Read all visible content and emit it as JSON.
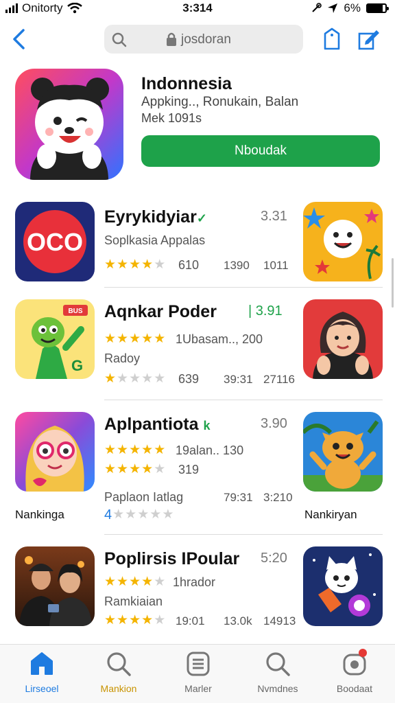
{
  "status": {
    "carrier": "Onitorty",
    "time": "3:314",
    "battery": "6%",
    "battery_level": 0.85
  },
  "nav": {
    "search_text": "josdoran"
  },
  "featured": {
    "title": "Indonnesia",
    "subtitle": "Appking.., Ronukain, Balan",
    "meta": "Mek  1091s",
    "button": "Nboudak",
    "icon": "bear-character-icon"
  },
  "apps": [
    {
      "name": "Eyrykidyiar",
      "name_mark": "✓",
      "score": "3.31",
      "line1": "Soplkasia Appalas",
      "rating_stars": 4,
      "rating_note": "610",
      "meta1": "1390",
      "meta2": "1011",
      "icon": "red-oco-logo-icon",
      "side_icon": "smiling-star-face-icon"
    },
    {
      "name": "Aqnkar Poder",
      "score": "| 3.91",
      "line1_stars": 5,
      "line1_note": "1Ubasam.., 200",
      "line2": "Radoy",
      "rating_stars": 1,
      "rating_note": "639",
      "meta1": "39:31",
      "meta2": "27116",
      "icon": "green-alien-character-icon",
      "side_icon": "waving-woman-icon",
      "icon_badge": "BUS"
    },
    {
      "name": "Aplpantiota",
      "name_mark": "k",
      "score": "3.90",
      "line1_stars": 5,
      "line1_note": "19alan.. 130",
      "line2_stars": 4,
      "line2_note": "319",
      "line3": "Paplaon Iatlag",
      "meta1": "79:31",
      "meta2": "3:210",
      "rating_stars": 0,
      "rating_prefix": "4",
      "caption_left": "Nankinga",
      "caption_right": "Nankiryan",
      "icon": "girl-with-glasses-icon",
      "side_icon": "orange-cat-character-icon"
    },
    {
      "name": "Poplirsis IPoular",
      "score": "5:20",
      "line1_stars": 4,
      "line1_note": "1hrador",
      "line2": "Ramkiaian",
      "rating_stars": 4,
      "meta1": "19:01",
      "meta2": "13.0k",
      "meta3": "14913",
      "icon": "couple-photo-icon",
      "side_icon": "cat-astronaut-icon"
    }
  ],
  "tabs": [
    {
      "label": "Lirseoel",
      "icon": "home-icon",
      "active": true
    },
    {
      "label": "Mankion",
      "icon": "search-icon",
      "active": false
    },
    {
      "label": "Marler",
      "icon": "list-icon",
      "active": false
    },
    {
      "label": "Nvmdnes",
      "icon": "search-icon",
      "active": false
    },
    {
      "label": "Boodaat",
      "icon": "updates-icon",
      "active": false
    }
  ],
  "colors": {
    "accent": "#1e7be0",
    "get_button": "#1ea24a",
    "star": "#f4b400",
    "active_tab_label": "#1e7be0",
    "search_tab_label": "#c89300"
  }
}
